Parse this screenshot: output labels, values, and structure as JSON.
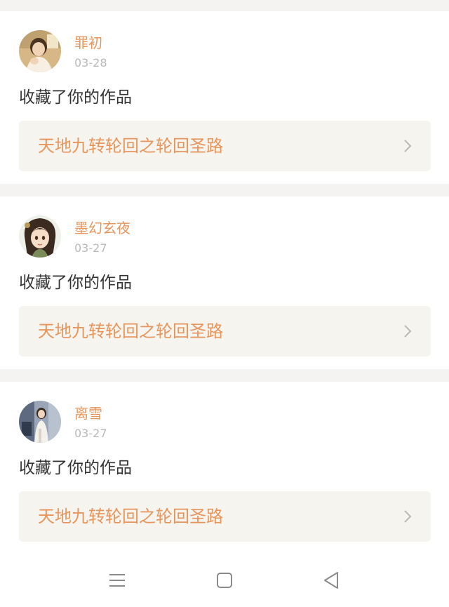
{
  "feed": {
    "items": [
      {
        "username": "罪初",
        "date": "03-28",
        "action": "收藏了你的作品",
        "work_title": "天地九转轮回之轮回圣路",
        "avatar_icon": "avatar-girl-photo"
      },
      {
        "username": "墨幻玄夜",
        "date": "03-27",
        "action": "收藏了你的作品",
        "work_title": "天地九转轮回之轮回圣路",
        "avatar_icon": "avatar-anime-character"
      },
      {
        "username": "离雪",
        "date": "03-27",
        "action": "收藏了你的作品",
        "work_title": "天地九转轮回之轮回圣路",
        "avatar_icon": "avatar-woman-photo"
      }
    ]
  },
  "navigation_bar": {
    "icons": [
      "menu-icon",
      "home-square-icon",
      "back-triangle-icon"
    ]
  },
  "colors": {
    "accent": "#e8955b",
    "background": "#f4f3f1",
    "card": "#ffffff",
    "link_bg": "#f5f4ef",
    "date": "#b9b9b9",
    "text": "#333333"
  }
}
